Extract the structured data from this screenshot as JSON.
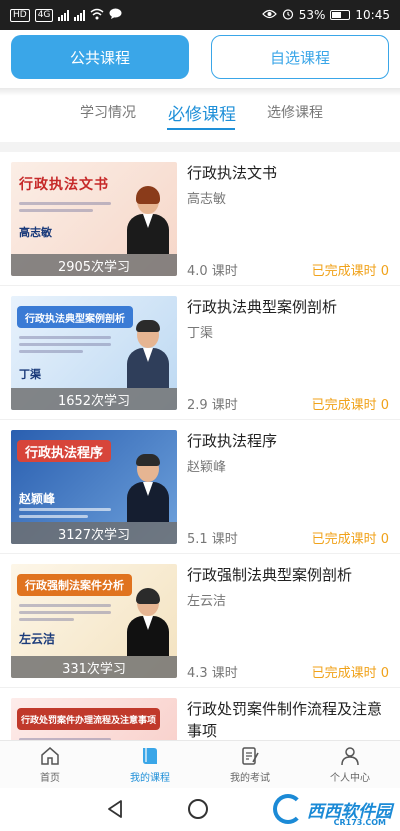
{
  "status_bar": {
    "hd": "HD",
    "network": "4G",
    "battery": "53%",
    "time": "10:45"
  },
  "top_buttons": {
    "public": "公共课程",
    "custom": "自选课程"
  },
  "tabs": {
    "study": "学习情况",
    "required": "必修课程",
    "elective": "选修课程",
    "active": "必修课程"
  },
  "courses": [
    {
      "title": "行政执法文书",
      "teacher": "高志敏",
      "plays": "2905次学习",
      "hours": "4.0 课时",
      "done": "已完成课时 0",
      "thumb_title": "行政执法文书",
      "thumb_name": "高志敏"
    },
    {
      "title": "行政执法典型案例剖析",
      "teacher": "丁渠",
      "plays": "1652次学习",
      "hours": "2.9 课时",
      "done": "已完成课时 0",
      "thumb_title": "行政执法典型案例剖析",
      "thumb_name": "丁渠"
    },
    {
      "title": "行政执法程序",
      "teacher": "赵颖峰",
      "plays": "3127次学习",
      "hours": "5.1 课时",
      "done": "已完成课时 0",
      "thumb_title": "行政执法程序",
      "thumb_name": "赵颖峰"
    },
    {
      "title": "行政强制法典型案例剖析",
      "teacher": "左云洁",
      "plays": "331次学习",
      "hours": "4.3 课时",
      "done": "已完成课时 0",
      "thumb_title": "行政强制法案件分析",
      "thumb_name": "左云洁"
    },
    {
      "title": "行政处罚案件制作流程及注意事项",
      "thumb_title": "行政处罚案件办理流程及注意事项"
    }
  ],
  "bottom_nav": {
    "home": "首页",
    "my_courses": "我的课程",
    "my_exams": "我的考试",
    "profile": "个人中心"
  },
  "watermark": {
    "brand": "西西软件园",
    "domain": "CR173.COM"
  },
  "colors": {
    "accent": "#3aa6e8",
    "tab_active": "#1e8fd8",
    "done": "#f0a21a"
  }
}
